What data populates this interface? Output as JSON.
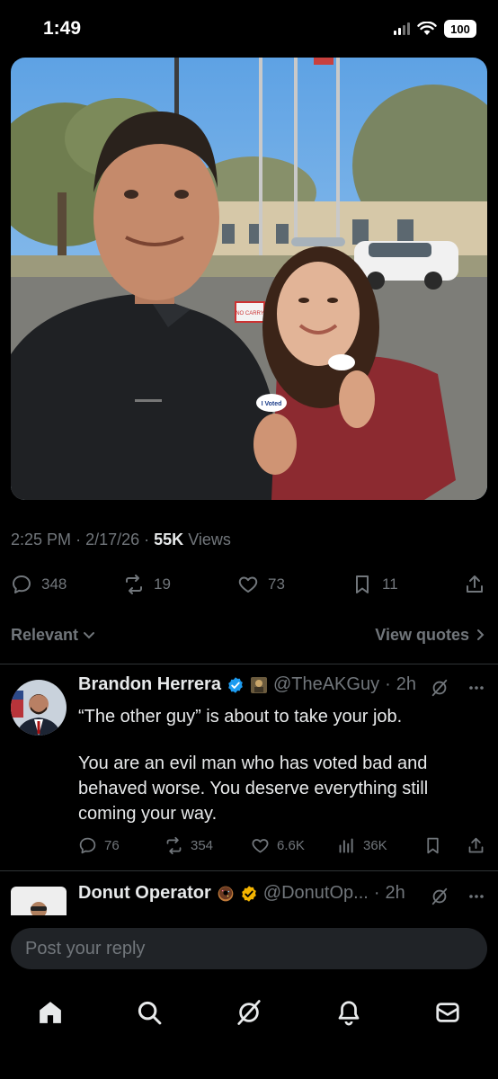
{
  "status_bar": {
    "time": "1:49",
    "battery": "100"
  },
  "tweet": {
    "time": "2:25 PM",
    "date": "2/17/26",
    "views_count": "55K",
    "views_label": "Views",
    "photo": {
      "sticker_text": "I Voted",
      "sign_text": "NO CARRY"
    },
    "actions": {
      "replies": "348",
      "reposts": "19",
      "likes": "73",
      "bookmarks": "11"
    }
  },
  "sort": {
    "label": "Relevant",
    "view_quotes": "View quotes"
  },
  "replies": [
    {
      "name": "Brandon Herrera",
      "handle": "@TheAKGuy",
      "time": "2h",
      "text_line1": "“The other guy” is about to take your job.",
      "text_body": "You are an evil man who has voted bad and\nbehaved worse. You deserve everything still\ncoming your way.",
      "replies": "76",
      "reposts": "354",
      "likes": "6.6K",
      "views": "36K"
    },
    {
      "name": "Donut Operator",
      "handle": "@DonutOp...",
      "time": "2h"
    }
  ],
  "composer": {
    "placeholder": "Post your reply"
  },
  "colors": {
    "background": "#000000",
    "muted": "#71767b",
    "verified": "#1d9bf0",
    "gold": "#f4b400"
  }
}
